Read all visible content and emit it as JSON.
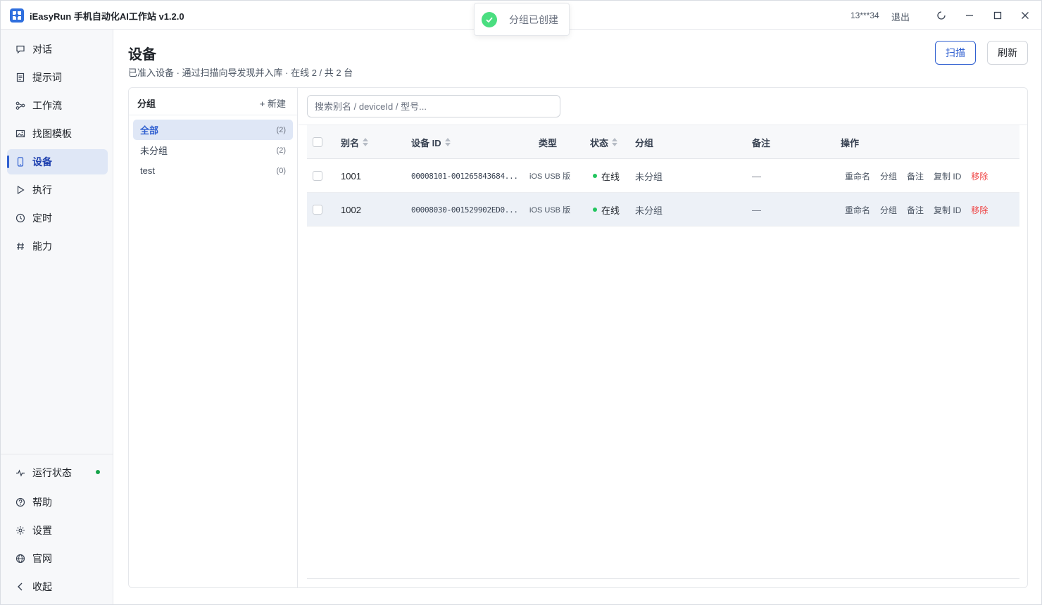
{
  "app": {
    "title": "iEasyRun 手机自动化AI工作站 v1.2.0"
  },
  "titlebar": {
    "user": "13***34",
    "logout": "退出"
  },
  "sidebar": {
    "items": [
      {
        "label": "对话",
        "icon": "chat-icon"
      },
      {
        "label": "提示词",
        "icon": "document-icon"
      },
      {
        "label": "工作流",
        "icon": "workflow-icon"
      },
      {
        "label": "找图模板",
        "icon": "image-icon"
      },
      {
        "label": "设备",
        "icon": "phone-icon",
        "active": true
      },
      {
        "label": "执行",
        "icon": "play-icon"
      },
      {
        "label": "定时",
        "icon": "clock-icon"
      },
      {
        "label": "能力",
        "icon": "hash-icon"
      }
    ],
    "bottom": [
      {
        "label": "运行状态",
        "icon": "pulse-icon"
      },
      {
        "label": "帮助",
        "icon": "help-icon"
      },
      {
        "label": "设置",
        "icon": "settings-icon"
      },
      {
        "label": "官网",
        "icon": "globe-icon"
      },
      {
        "label": "收起",
        "icon": "chevron-left-icon"
      }
    ],
    "status_color": "#16a34a"
  },
  "page": {
    "title": "设备",
    "subtitle": "已准入设备 · 通过扫描向导发现并入库 · 在线 2 / 共 2 台",
    "scan_label": "扫描",
    "refresh_label": "刷新"
  },
  "groups": {
    "title": "分组",
    "new_label": "+ 新建",
    "items": [
      {
        "name": "全部",
        "count": "(2)",
        "active": true
      },
      {
        "name": "未分组",
        "count": "(2)"
      },
      {
        "name": "test",
        "count": "(0)"
      }
    ]
  },
  "search": {
    "placeholder": "搜索别名 / deviceId / 型号..."
  },
  "table": {
    "headers": {
      "alias": "别名",
      "device_id": "设备 ID",
      "type": "类型",
      "status": "状态",
      "group": "分组",
      "note": "备注",
      "actions": "操作"
    },
    "rows": [
      {
        "alias": "1001",
        "device_id": "00008101-001265843684...",
        "type": "iOS USB 版",
        "status": "在线",
        "group": "未分组",
        "note": "—",
        "actions": [
          "重命名",
          "分组",
          "备注",
          "复制 ID",
          "移除"
        ]
      },
      {
        "alias": "1002",
        "device_id": "00008030-001529902ED0...",
        "type": "iOS USB 版",
        "status": "在线",
        "group": "未分组",
        "note": "—",
        "actions": [
          "重命名",
          "分组",
          "备注",
          "复制 ID",
          "移除"
        ]
      }
    ]
  },
  "toast": {
    "message": "分组已创建",
    "icon": "check-circle-icon"
  },
  "colors": {
    "accent": "#2f5fd0",
    "online": "#22c55e",
    "danger": "#ef4444"
  }
}
